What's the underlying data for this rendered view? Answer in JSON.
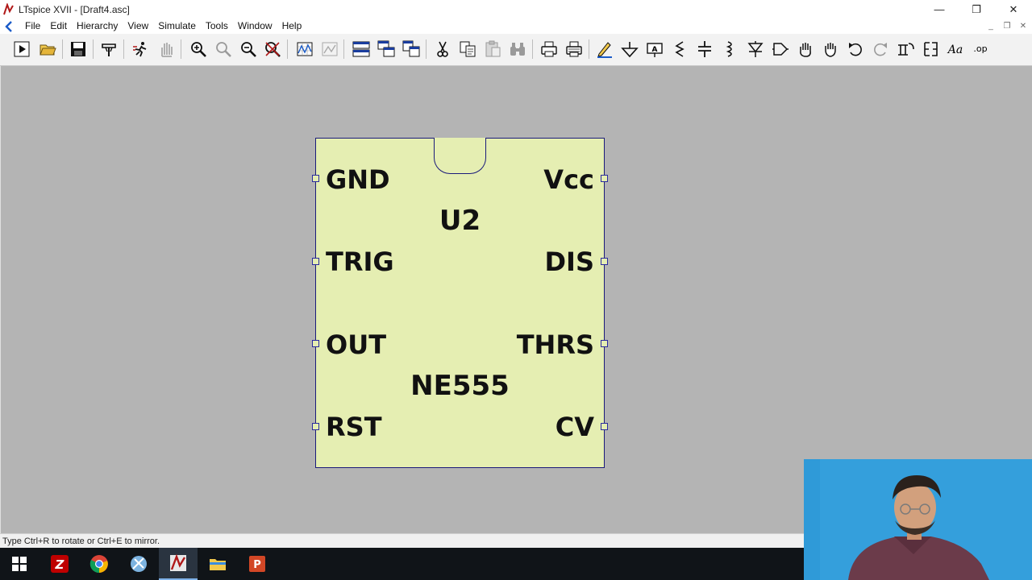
{
  "window": {
    "title": "LTspice XVII - [Draft4.asc]",
    "minimize": "—",
    "restore": "❐",
    "close": "✕"
  },
  "menu": {
    "items": [
      "File",
      "Edit",
      "Hierarchy",
      "View",
      "Simulate",
      "Tools",
      "Window",
      "Help"
    ],
    "mdi_minimize": "_",
    "mdi_restore": "❐",
    "mdi_close": "✕"
  },
  "toolbar": {
    "buttons": [
      "run",
      "open",
      "save",
      "control-panel",
      "halt",
      "pan",
      "zoom-in",
      "zoom-full",
      "zoom-out",
      "zoom-cancel",
      "waveform",
      "autorange",
      "tile-horizontal",
      "cascade",
      "tile-vertical",
      "cut",
      "copy",
      "paste",
      "find",
      "print",
      "print-setup",
      "wire",
      "ground",
      "label-net",
      "resistor",
      "capacitor",
      "inductor",
      "diode",
      "component",
      "move",
      "drag",
      "undo",
      "redo",
      "rotate",
      "mirror",
      "text",
      "spice-directive"
    ]
  },
  "schematic": {
    "component": {
      "instance": "U2",
      "part": "NE555",
      "pins_left": [
        "GND",
        "TRIG",
        "OUT",
        "RST"
      ],
      "pins_right": [
        "Vcc",
        "DIS",
        "THRS",
        "CV"
      ],
      "fill_color": "#e5eeb2",
      "outline_color": "#1a1a7a"
    }
  },
  "status": {
    "text": "Type Ctrl+R to rotate or Ctrl+E to mirror."
  },
  "taskbar": {
    "apps": [
      "start",
      "filezilla",
      "chrome",
      "snipping-tool",
      "ltspice",
      "file-explorer",
      "powerpoint"
    ]
  }
}
